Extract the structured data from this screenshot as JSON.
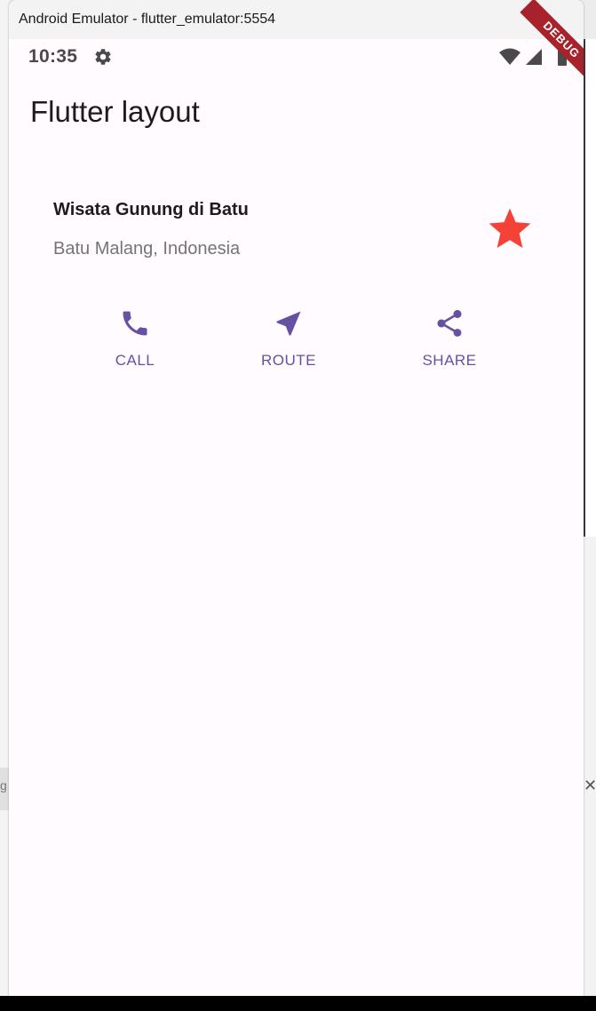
{
  "window": {
    "title": "Android Emulator - flutter_emulator:5554"
  },
  "status_bar": {
    "time": "10:35",
    "settings_icon": "gear-icon",
    "wifi_icon": "wifi-icon",
    "signal_icon": "signal-icon",
    "battery_icon": "battery-icon"
  },
  "debug_banner": {
    "label": "DEBUG",
    "color": "#a8222c"
  },
  "app_bar": {
    "title": "Flutter layout"
  },
  "title_section": {
    "name": "Wisata Gunung di Batu",
    "location": "Batu Malang, Indonesia",
    "favorite_icon": "star-icon",
    "star_color": "#f44336"
  },
  "buttons": [
    {
      "label": "CALL",
      "icon": "call-icon"
    },
    {
      "label": "ROUTE",
      "icon": "near-me-icon"
    },
    {
      "label": "SHARE",
      "icon": "share-icon"
    }
  ],
  "colors": {
    "accent": "#6750a4",
    "background": "#fffbfe",
    "text_primary": "#1d1b20",
    "text_secondary": "#757575"
  },
  "background_window": {
    "close_glyph": "✕",
    "partial_text": "g"
  }
}
